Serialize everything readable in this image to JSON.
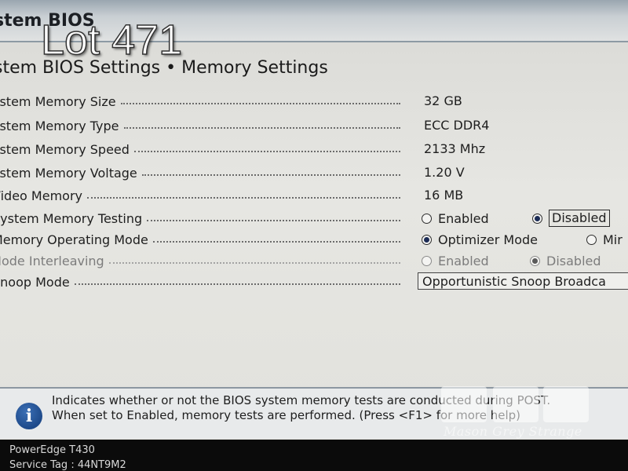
{
  "header": {
    "app_title": "stem BIOS",
    "breadcrumb": "stem BIOS Settings • Memory Settings"
  },
  "overlay": {
    "lot_label": "Lot 471",
    "watermark": "Mason Grey Strange"
  },
  "settings": [
    {
      "label": "ystem Memory Size",
      "value": "32 GB"
    },
    {
      "label": "ystem Memory Type",
      "value": "ECC DDR4"
    },
    {
      "label": "ystem Memory Speed",
      "value": "2133 Mhz"
    },
    {
      "label": "ystem Memory Voltage",
      "value": "1.20 V"
    },
    {
      "label": "Video Memory",
      "value": "16 MB"
    },
    {
      "label": "System Memory Testing",
      "options": [
        "Enabled",
        "Disabled"
      ],
      "selected": "Disabled"
    },
    {
      "label": "Memory Operating Mode",
      "options": [
        "Optimizer Mode",
        "Mir"
      ],
      "selected": "Optimizer Mode"
    },
    {
      "label": "Node Interleaving",
      "options": [
        "Enabled",
        "Disabled"
      ],
      "selected": "Disabled",
      "disabled": true
    },
    {
      "label": "Snoop Mode",
      "value": "Opportunistic Snoop Broadca"
    }
  ],
  "help": {
    "icon": "info-icon",
    "line1": "Indicates whether or not the BIOS system memory tests are conducted during POST.",
    "line2": "When set to Enabled, memory tests are performed. (Press <F1> for more help)"
  },
  "footer": {
    "model": "PowerEdge T430",
    "service_tag": "Service Tag : 44NT9M2"
  },
  "colors": {
    "background": "#e3e3df",
    "header": "#c9cfd3",
    "radio_selected": "#1b2b55",
    "info_icon": "#1e4a8a",
    "footer": "#0b0b0b"
  }
}
